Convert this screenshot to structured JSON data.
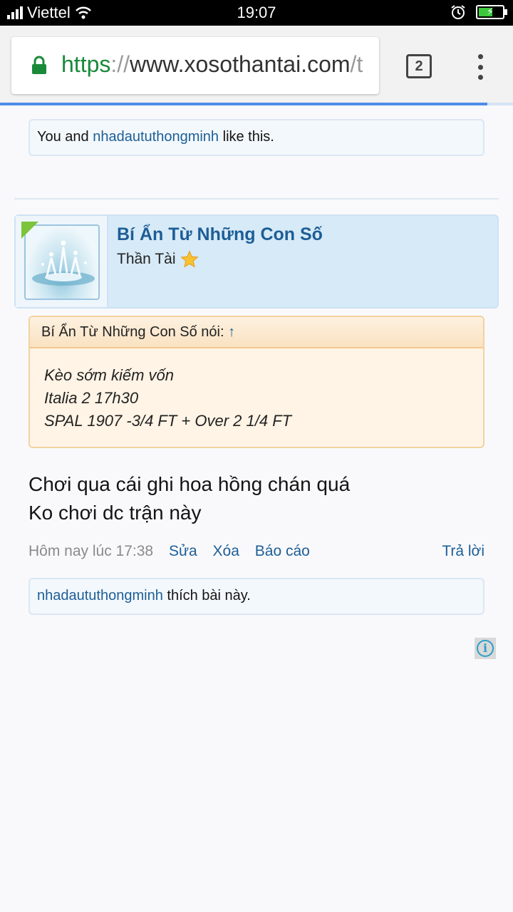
{
  "status_bar": {
    "carrier": "Viettel",
    "time": "19:07",
    "battery_level": 0.6
  },
  "browser": {
    "url_scheme": "https",
    "url_sep": "://",
    "url_host": "www.xosothantai.com",
    "url_tail": "/t",
    "tab_count": "2",
    "load_progress": 0.95
  },
  "top_like": {
    "prefix": "You and ",
    "user": "nhadaututhongminh",
    "suffix": " like this."
  },
  "post": {
    "username": "Bí Ẩn Từ Những Con Số",
    "user_title": "Thần Tài",
    "quote": {
      "header": "Bí Ẩn Từ Những Con Số nói: ",
      "arrow": "↑",
      "lines": [
        "Kèo sớm kiếm vốn",
        "Italia 2 17h30",
        "SPAL 1907 -3/4 FT + Over 2 1/4 FT"
      ]
    },
    "message_lines": [
      "Chơi qua cái ghi hoa hồng chán quá",
      "Ko chơi dc trận này"
    ],
    "date": "Hôm nay lúc 17:38",
    "actions": {
      "edit": "Sửa",
      "delete": "Xóa",
      "report": "Báo cáo",
      "reply": "Trả lời"
    },
    "like": {
      "user": "nhadaututhongminh",
      "suffix": " thích bài này."
    }
  },
  "icons": {
    "lock": "lock-icon",
    "star": "star-icon",
    "info": "info-icon"
  },
  "colors": {
    "link": "#1d5e96",
    "secure_green": "#1a8a3a",
    "online_green": "#7cc43a"
  }
}
